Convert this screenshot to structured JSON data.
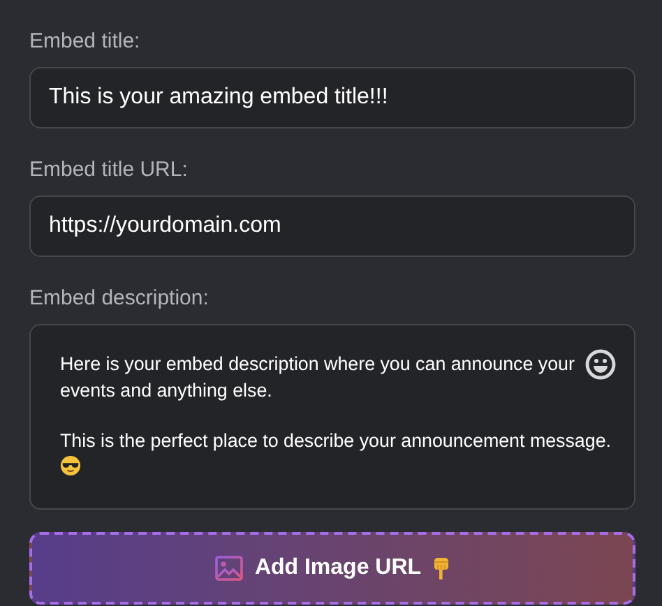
{
  "fields": [
    {
      "kind": "input",
      "label": "Embed title:",
      "value": "This is your amazing embed title!!!"
    },
    {
      "kind": "input",
      "label": "Embed title URL:",
      "value": "https://yourdomain.com"
    },
    {
      "kind": "textarea",
      "label": "Embed description:",
      "paragraphs": [
        "Here is your embed description where you can announce your events and anything else.",
        "This is the perfect place to describe your announcement message."
      ]
    }
  ],
  "add_image_button": {
    "label": "Add Image URL"
  }
}
